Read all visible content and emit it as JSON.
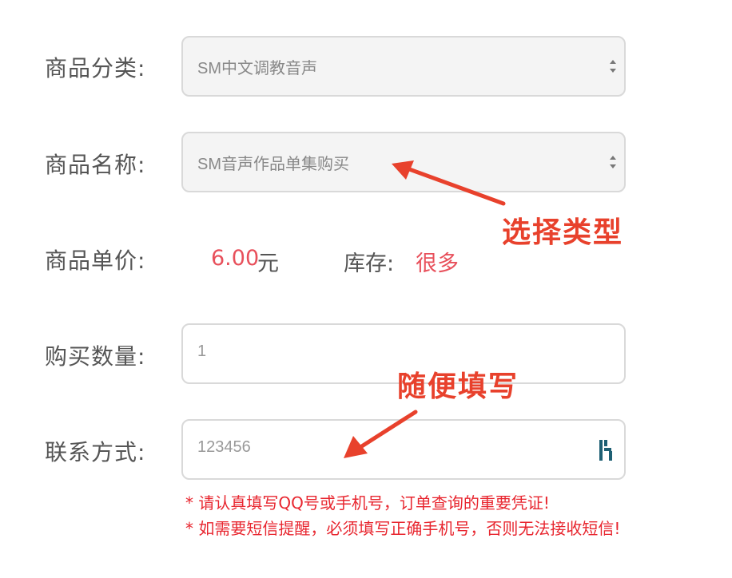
{
  "form": {
    "category": {
      "label": "商品分类:",
      "value": "SM中文调教音声"
    },
    "name": {
      "label": "商品名称:",
      "value": "SM音声作品单集购买"
    },
    "price": {
      "label": "商品单价:",
      "value": "6.00",
      "unit": "元"
    },
    "stock": {
      "label": "库存:",
      "value": "很多"
    },
    "quantity": {
      "label": "购买数量:",
      "placeholder": "1"
    },
    "contact": {
      "label": "联系方式:",
      "placeholder": "123456"
    }
  },
  "notes": [
    "* 请认真填写QQ号或手机号，订单查询的重要凭证!",
    "* 如需要短信提醒，必须填写正确手机号，否则无法接收短信!"
  ],
  "annotations": {
    "select_type": "选择类型",
    "fill_anything": "随便填写"
  },
  "colors": {
    "accent_red": "#e8505b",
    "annotation_red": "#e8412c",
    "note_red": "#e8262f"
  },
  "icons": {
    "select_arrows": "updown-arrows-icon",
    "password_manager": "password-manager-icon"
  }
}
